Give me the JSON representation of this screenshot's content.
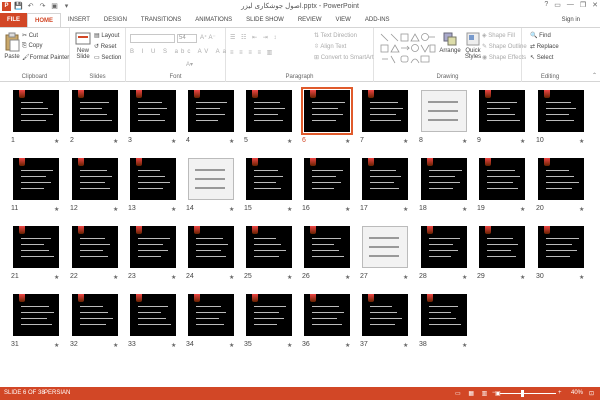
{
  "window": {
    "title": "اصول جوشکاری لیزر.pptx - PowerPoint",
    "controls": [
      "?",
      "▭",
      "—",
      "❐",
      "✕"
    ]
  },
  "qat": {
    "save": "💾",
    "undo": "↶",
    "redo": "↷",
    "start": "▣",
    "more": "▾"
  },
  "ribbon_tabs": {
    "file": "FILE",
    "items": [
      "HOME",
      "INSERT",
      "DESIGN",
      "TRANSITIONS",
      "ANIMATIONS",
      "SLIDE SHOW",
      "REVIEW",
      "VIEW",
      "ADD-INS"
    ],
    "active": "HOME",
    "signin": "Sign in"
  },
  "ribbon": {
    "clipboard": {
      "paste": "Paste",
      "cut": "Cut",
      "copy": "Copy",
      "format_painter": "Format Painter",
      "label": "Clipboard"
    },
    "slides": {
      "new_slide": "New Slide",
      "layout": "Layout",
      "reset": "Reset",
      "section": "Section",
      "label": "Slides"
    },
    "font": {
      "size": "54",
      "label": "Font"
    },
    "paragraph": {
      "text_direction": "Text Direction",
      "align_text": "Align Text",
      "convert": "Convert to SmartArt",
      "label": "Paragraph"
    },
    "drawing": {
      "arrange": "Arrange",
      "quick_styles": "Quick Styles",
      "shape_fill": "Shape Fill",
      "shape_outline": "Shape Outline",
      "shape_effects": "Shape Effects",
      "label": "Drawing"
    },
    "editing": {
      "find": "Find",
      "replace": "Replace",
      "select": "Select",
      "label": "Editing"
    }
  },
  "slides": {
    "count": 38,
    "selected": 6,
    "thumbs": [
      {
        "n": "1",
        "s": "dark"
      },
      {
        "n": "2",
        "s": "dark"
      },
      {
        "n": "3",
        "s": "dark"
      },
      {
        "n": "4",
        "s": "dark"
      },
      {
        "n": "5",
        "s": "dark"
      },
      {
        "n": "6",
        "s": "dark"
      },
      {
        "n": "7",
        "s": "dark"
      },
      {
        "n": "8",
        "s": "light"
      },
      {
        "n": "9",
        "s": "dark"
      },
      {
        "n": "10",
        "s": "dark"
      },
      {
        "n": "11",
        "s": "dark"
      },
      {
        "n": "12",
        "s": "dark"
      },
      {
        "n": "13",
        "s": "dark"
      },
      {
        "n": "14",
        "s": "light"
      },
      {
        "n": "15",
        "s": "dark"
      },
      {
        "n": "16",
        "s": "dark"
      },
      {
        "n": "17",
        "s": "dark"
      },
      {
        "n": "18",
        "s": "dark"
      },
      {
        "n": "19",
        "s": "dark"
      },
      {
        "n": "20",
        "s": "dark"
      },
      {
        "n": "21",
        "s": "dark"
      },
      {
        "n": "22",
        "s": "dark"
      },
      {
        "n": "23",
        "s": "dark"
      },
      {
        "n": "24",
        "s": "dark"
      },
      {
        "n": "25",
        "s": "dark"
      },
      {
        "n": "26",
        "s": "dark"
      },
      {
        "n": "27",
        "s": "light"
      },
      {
        "n": "28",
        "s": "dark"
      },
      {
        "n": "29",
        "s": "dark"
      },
      {
        "n": "30",
        "s": "dark"
      },
      {
        "n": "31",
        "s": "dark"
      },
      {
        "n": "32",
        "s": "dark"
      },
      {
        "n": "33",
        "s": "dark"
      },
      {
        "n": "34",
        "s": "dark"
      },
      {
        "n": "35",
        "s": "dark"
      },
      {
        "n": "36",
        "s": "dark"
      },
      {
        "n": "37",
        "s": "dark"
      },
      {
        "n": "38",
        "s": "dark"
      }
    ],
    "star": "★"
  },
  "status": {
    "slide_info": "SLIDE 6 OF 38",
    "language": "PERSIAN",
    "zoom": "40%",
    "zoom_fraction": 0.4
  },
  "colors": {
    "accent": "#d24726",
    "selection": "#e05a2b"
  }
}
